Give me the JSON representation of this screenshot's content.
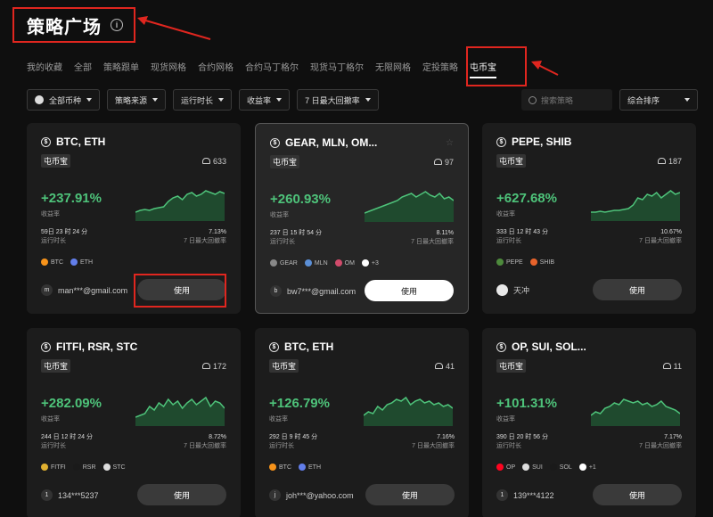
{
  "header": {
    "title": "策略广场",
    "info_icon": "info-icon"
  },
  "tabs": [
    "我的收藏",
    "全部",
    "策略跟单",
    "现货网格",
    "合约网格",
    "合约马丁格尔",
    "现货马丁格尔",
    "无限网格",
    "定投策略",
    "屯币宝"
  ],
  "active_tab": "屯币宝",
  "filters": [
    {
      "label": "全部币种",
      "icon": "coin-icon"
    },
    {
      "label": "策略来源"
    },
    {
      "label": "运行时长"
    },
    {
      "label": "收益率"
    },
    {
      "label": "7 日最大回撤率"
    }
  ],
  "search": {
    "placeholder": "搜索策略"
  },
  "sort": {
    "label": "综合排序"
  },
  "labels": {
    "return": "收益率",
    "runtime": "运行时长",
    "drawdown": "7 日最大回撤率",
    "use": "使用"
  },
  "cards": [
    {
      "name": "BTC, ETH",
      "badge": "屯币宝",
      "users": "633",
      "return": "+237.91%",
      "runtime": "59日 23 时 24 分",
      "drawdown": "7.13%",
      "coins": [
        {
          "name": "BTC",
          "color": "#f7931a"
        },
        {
          "name": "ETH",
          "color": "#627eea"
        }
      ],
      "owner": "man***@gmail.com",
      "avatar": "m"
    },
    {
      "name": "GEAR, MLN, OM...",
      "badge": "屯币宝",
      "users": "97",
      "return": "+260.93%",
      "runtime": "237 日 15 时 54 分",
      "drawdown": "8.11%",
      "coins": [
        {
          "name": "GEAR",
          "color": "#888888"
        },
        {
          "name": "MLN",
          "color": "#5b8fd6"
        },
        {
          "name": "OM",
          "color": "#d14b6b"
        },
        {
          "name": "+3",
          "color": "#ffffff"
        }
      ],
      "owner": "bw7***@gmail.com",
      "avatar": "b"
    },
    {
      "name": "PEPE, SHIB",
      "badge": "屯币宝",
      "users": "187",
      "return": "+627.68%",
      "runtime": "333 日 12 时 43 分",
      "drawdown": "10.67%",
      "coins": [
        {
          "name": "PEPE",
          "color": "#4d8a3c"
        },
        {
          "name": "SHIB",
          "color": "#e8632b"
        }
      ],
      "owner": "天冲",
      "avatar": ""
    },
    {
      "name": "FITFI, RSR, STC",
      "badge": "屯币宝",
      "users": "172",
      "return": "+282.09%",
      "runtime": "244 日 12 时 24 分",
      "drawdown": "8.72%",
      "coins": [
        {
          "name": "FITFI",
          "color": "#e0b030"
        },
        {
          "name": "RSR",
          "color": "#1a1a1a"
        },
        {
          "name": "STC",
          "color": "#dddddd"
        }
      ],
      "owner": "134***5237",
      "avatar": "1"
    },
    {
      "name": "BTC, ETH",
      "badge": "屯币宝",
      "users": "41",
      "return": "+126.79%",
      "runtime": "292 日 9 时 45 分",
      "drawdown": "7.16%",
      "coins": [
        {
          "name": "BTC",
          "color": "#f7931a"
        },
        {
          "name": "ETH",
          "color": "#627eea"
        }
      ],
      "owner": "joh***@yahoo.com",
      "avatar": "j"
    },
    {
      "name": "OP, SUI, SOL...",
      "badge": "屯币宝",
      "users": "11",
      "return": "+101.31%",
      "runtime": "390 日 20 时 56 分",
      "drawdown": "7.17%",
      "coins": [
        {
          "name": "OP",
          "color": "#ff0420"
        },
        {
          "name": "SUI",
          "color": "#dddddd"
        },
        {
          "name": "SOL",
          "color": "#1a1a1a"
        },
        {
          "name": "+1",
          "color": "#ffffff"
        }
      ],
      "owner": "139***4122",
      "avatar": "1"
    }
  ]
}
